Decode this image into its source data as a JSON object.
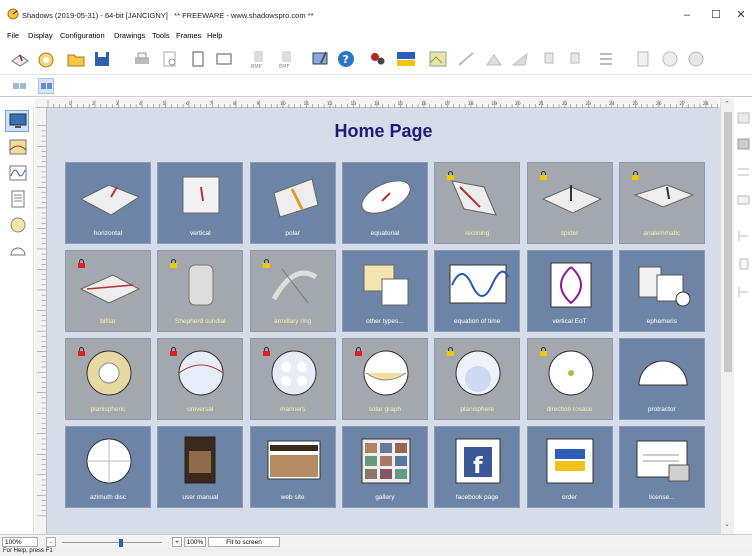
{
  "window": {
    "title": "Shadows (2019-05-31) - 64-bit [JANCIGNY]   ** FREEWARE - www.shadowspro.com **",
    "minimize": "–",
    "maximize": "☐",
    "close": "✕"
  },
  "menu": [
    "File",
    "Display",
    "Configuration",
    "Drawings",
    "Tools",
    "Frames",
    "Help"
  ],
  "toolbar": {
    "bmp1": "BMP",
    "emf": "EMF",
    "help": "?",
    "paypal": "PayPal"
  },
  "page": {
    "title": "Home Page"
  },
  "tiles": [
    {
      "label": "horizontal",
      "locked": false,
      "style": "blue"
    },
    {
      "label": "vertical",
      "locked": false,
      "style": "blue"
    },
    {
      "label": "polar",
      "locked": false,
      "style": "blue"
    },
    {
      "label": "equatorial",
      "locked": false,
      "style": "blue"
    },
    {
      "label": "reclining",
      "locked": true,
      "style": "gray"
    },
    {
      "label": "spider",
      "locked": true,
      "style": "gray"
    },
    {
      "label": "analemmatic",
      "locked": true,
      "style": "gray"
    },
    {
      "label": "bifilar",
      "locked": true,
      "style": "gray"
    },
    {
      "label": "Shepherd sundial",
      "locked": true,
      "style": "gray"
    },
    {
      "label": "armillary ring",
      "locked": true,
      "style": "gray"
    },
    {
      "label": "other types...",
      "locked": false,
      "style": "blue"
    },
    {
      "label": "equation of time",
      "locked": false,
      "style": "blue"
    },
    {
      "label": "vertical EoT",
      "locked": false,
      "style": "blue"
    },
    {
      "label": "ephemeris",
      "locked": false,
      "style": "blue"
    },
    {
      "label": "planispheric",
      "locked": true,
      "style": "gray"
    },
    {
      "label": "universal",
      "locked": true,
      "style": "gray"
    },
    {
      "label": "mariners",
      "locked": true,
      "style": "gray"
    },
    {
      "label": "solar graph",
      "locked": true,
      "style": "gray"
    },
    {
      "label": "planisphere",
      "locked": true,
      "style": "gray"
    },
    {
      "label": "direction rosace",
      "locked": true,
      "style": "gray"
    },
    {
      "label": "protractor",
      "locked": false,
      "style": "blue"
    },
    {
      "label": "azimuth disc",
      "locked": false,
      "style": "blue"
    },
    {
      "label": "user manual",
      "locked": false,
      "style": "blue"
    },
    {
      "label": "web site",
      "locked": false,
      "style": "blue"
    },
    {
      "label": "gallery",
      "locked": false,
      "style": "blue"
    },
    {
      "label": "facebook page",
      "locked": false,
      "style": "blue"
    },
    {
      "label": "order",
      "locked": false,
      "style": "blue"
    },
    {
      "label": "license...",
      "locked": false,
      "style": "blue"
    }
  ],
  "ruler": {
    "h_ticks": [
      "1",
      "2",
      "3",
      "4",
      "5",
      "6",
      "7",
      "8",
      "9",
      "10",
      "11",
      "12",
      "13",
      "14",
      "15",
      "16",
      "17",
      "18",
      "19",
      "20",
      "21",
      "22",
      "23",
      "24",
      "25",
      "26",
      "27",
      "28"
    ]
  },
  "status": {
    "zoom": "100%",
    "zoom_minus": "-",
    "zoom_plus": "+",
    "zoom_value": "100%",
    "fit": "Fit to screen",
    "help": "For Help, press F1"
  },
  "colors": {
    "tile_blue": "#6d84a6",
    "tile_gray": "#a3a7ae",
    "canvas": "#d6dce8",
    "title": "#1c1a7a"
  }
}
